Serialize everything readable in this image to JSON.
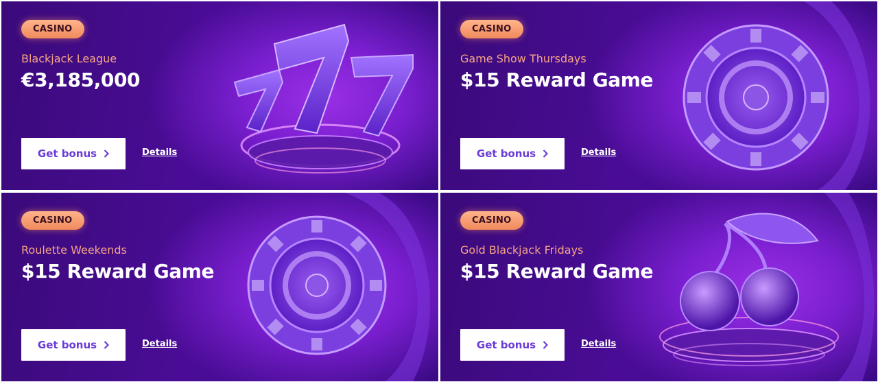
{
  "cards": [
    {
      "badge": "CASINO",
      "subtitle": "Blackjack League",
      "headline": "€3,185,000",
      "button_label": "Get bonus",
      "details_label": "Details",
      "art_icon": "lucky-seven-icon"
    },
    {
      "badge": "CASINO",
      "subtitle": "Game Show Thursdays",
      "headline": "$15 Reward Game",
      "button_label": "Get bonus",
      "details_label": "Details",
      "art_icon": "roulette-wheel-icon"
    },
    {
      "badge": "CASINO",
      "subtitle": "Roulette Weekends",
      "headline": "$15 Reward Game",
      "button_label": "Get bonus",
      "details_label": "Details",
      "art_icon": "roulette-wheel-icon"
    },
    {
      "badge": "CASINO",
      "subtitle": "Gold Blackjack Fridays",
      "headline": "$15 Reward Game",
      "button_label": "Get bonus",
      "details_label": "Details",
      "art_icon": "cherries-icon"
    }
  ],
  "colors": {
    "card_background": "#4a0c96",
    "badge": "#f5a07a",
    "subtitle": "#f7a585",
    "button_text": "#6a3bd8",
    "headline": "#ffffff"
  }
}
